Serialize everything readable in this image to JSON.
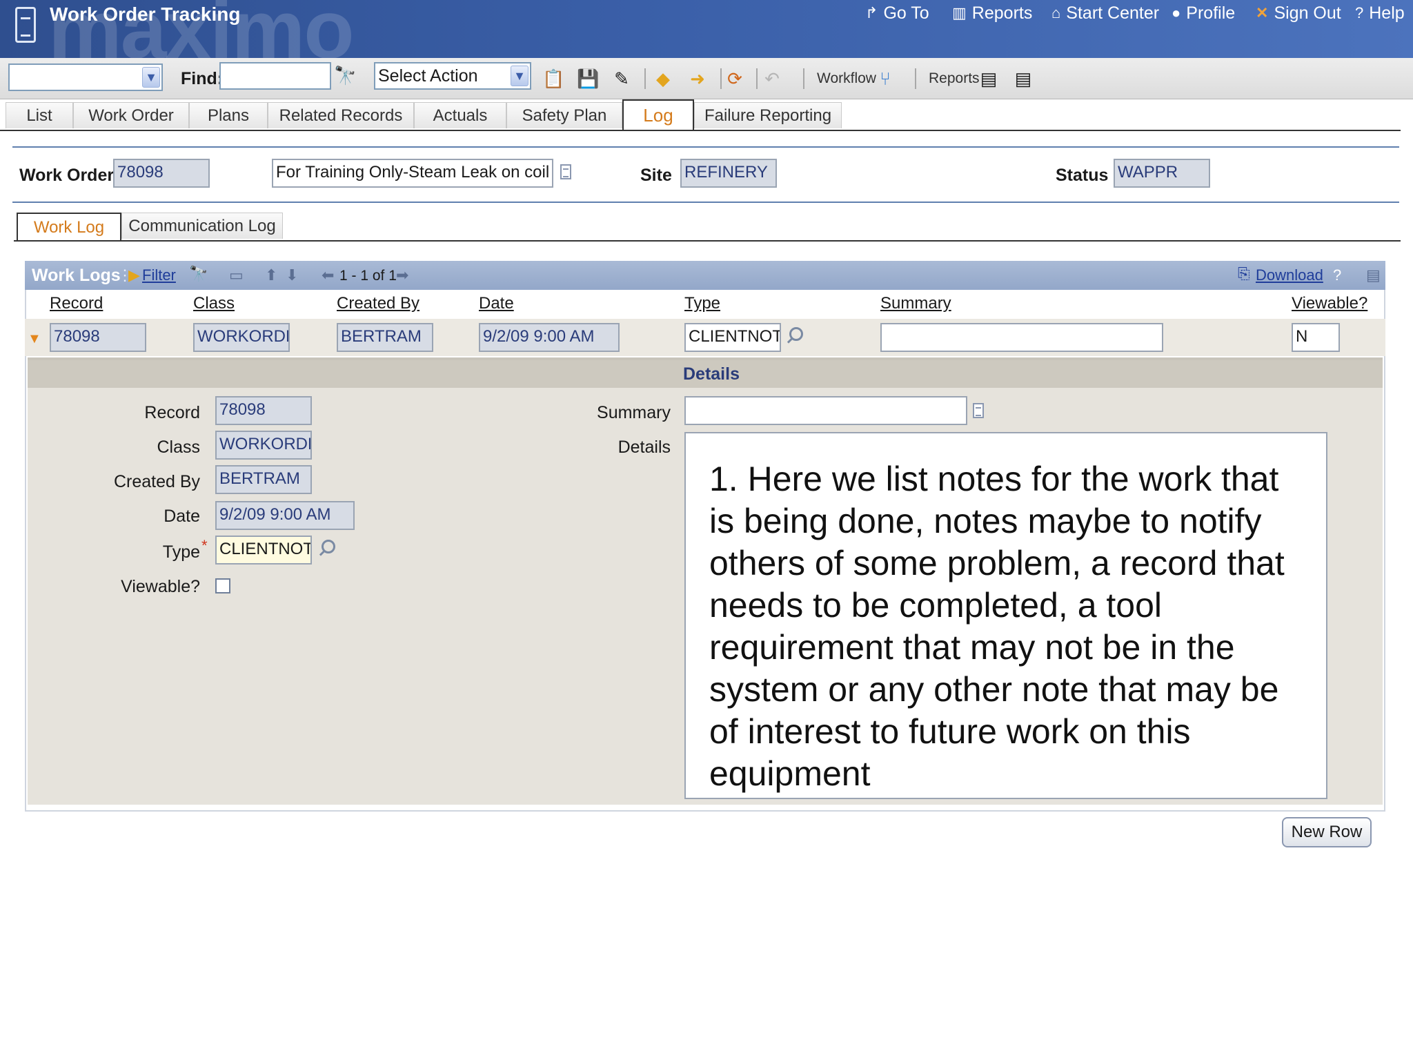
{
  "header": {
    "app_title": "Work Order Tracking",
    "watermark": "maximo",
    "links": [
      {
        "label": "Go To",
        "icon": "arrow-icon"
      },
      {
        "label": "Reports",
        "icon": "chart-icon"
      },
      {
        "label": "Start Center",
        "icon": "home-icon"
      },
      {
        "label": "Profile",
        "icon": "person-icon"
      },
      {
        "label": "Sign Out",
        "icon": "x-icon"
      },
      {
        "label": "Help",
        "icon": "question-icon"
      }
    ]
  },
  "toolbar": {
    "query_value": "",
    "find_label": "Find:",
    "find_value": "",
    "action_select": "Select Action",
    "workflow_label": "Workflow",
    "reports_label": "Reports"
  },
  "tabs": [
    "List",
    "Work Order",
    "Plans",
    "Related Records",
    "Actuals",
    "Safety Plan",
    "Log",
    "Failure Reporting"
  ],
  "active_tab": "Log",
  "work_order": {
    "wo_label": "Work Order",
    "wo_value": "78098",
    "description": "For Training Only-Steam Leak on coil",
    "site_label": "Site",
    "site_value": "REFINERY",
    "status_label": "Status",
    "status_value": "WAPPR"
  },
  "subtabs": [
    "Work Log",
    "Communication Log"
  ],
  "table": {
    "title": "Work Logs",
    "filter_label": "Filter",
    "paging": "1 - 1 of 1",
    "download_label": "Download",
    "help_glyph": "?",
    "columns": [
      "Record",
      "Class",
      "Created By",
      "Date",
      "Type",
      "Summary",
      "Viewable?"
    ],
    "row": {
      "record": "78098",
      "class": "WORKORDER",
      "created_by": "BERTRAM",
      "date": "9/2/09 9:00 AM",
      "type": "CLIENTNOTE",
      "summary": "",
      "viewable": "N"
    }
  },
  "details": {
    "title": "Details",
    "labels": {
      "record": "Record",
      "class": "Class",
      "created_by": "Created By",
      "date": "Date",
      "type": "Type",
      "required_mark": "*",
      "viewable": "Viewable?",
      "summary": "Summary",
      "details": "Details"
    },
    "values": {
      "record": "78098",
      "class": "WORKORDER",
      "created_by": "BERTRAM",
      "date": "9/2/09 9:00 AM",
      "type": "CLIENTNOTE",
      "summary": ""
    },
    "details_text": "1. Here we list notes for the work that is being done, notes maybe to notify others of some problem, a record that needs to be completed, a tool requirement that may not be in the system or any other note that may be of interest to future work on this equipment"
  },
  "new_row_label": "New Row",
  "colors": {
    "header_blue": "#3a5fa8",
    "active_tab": "#d47b1c",
    "readonly_bg": "#d7dce5"
  }
}
